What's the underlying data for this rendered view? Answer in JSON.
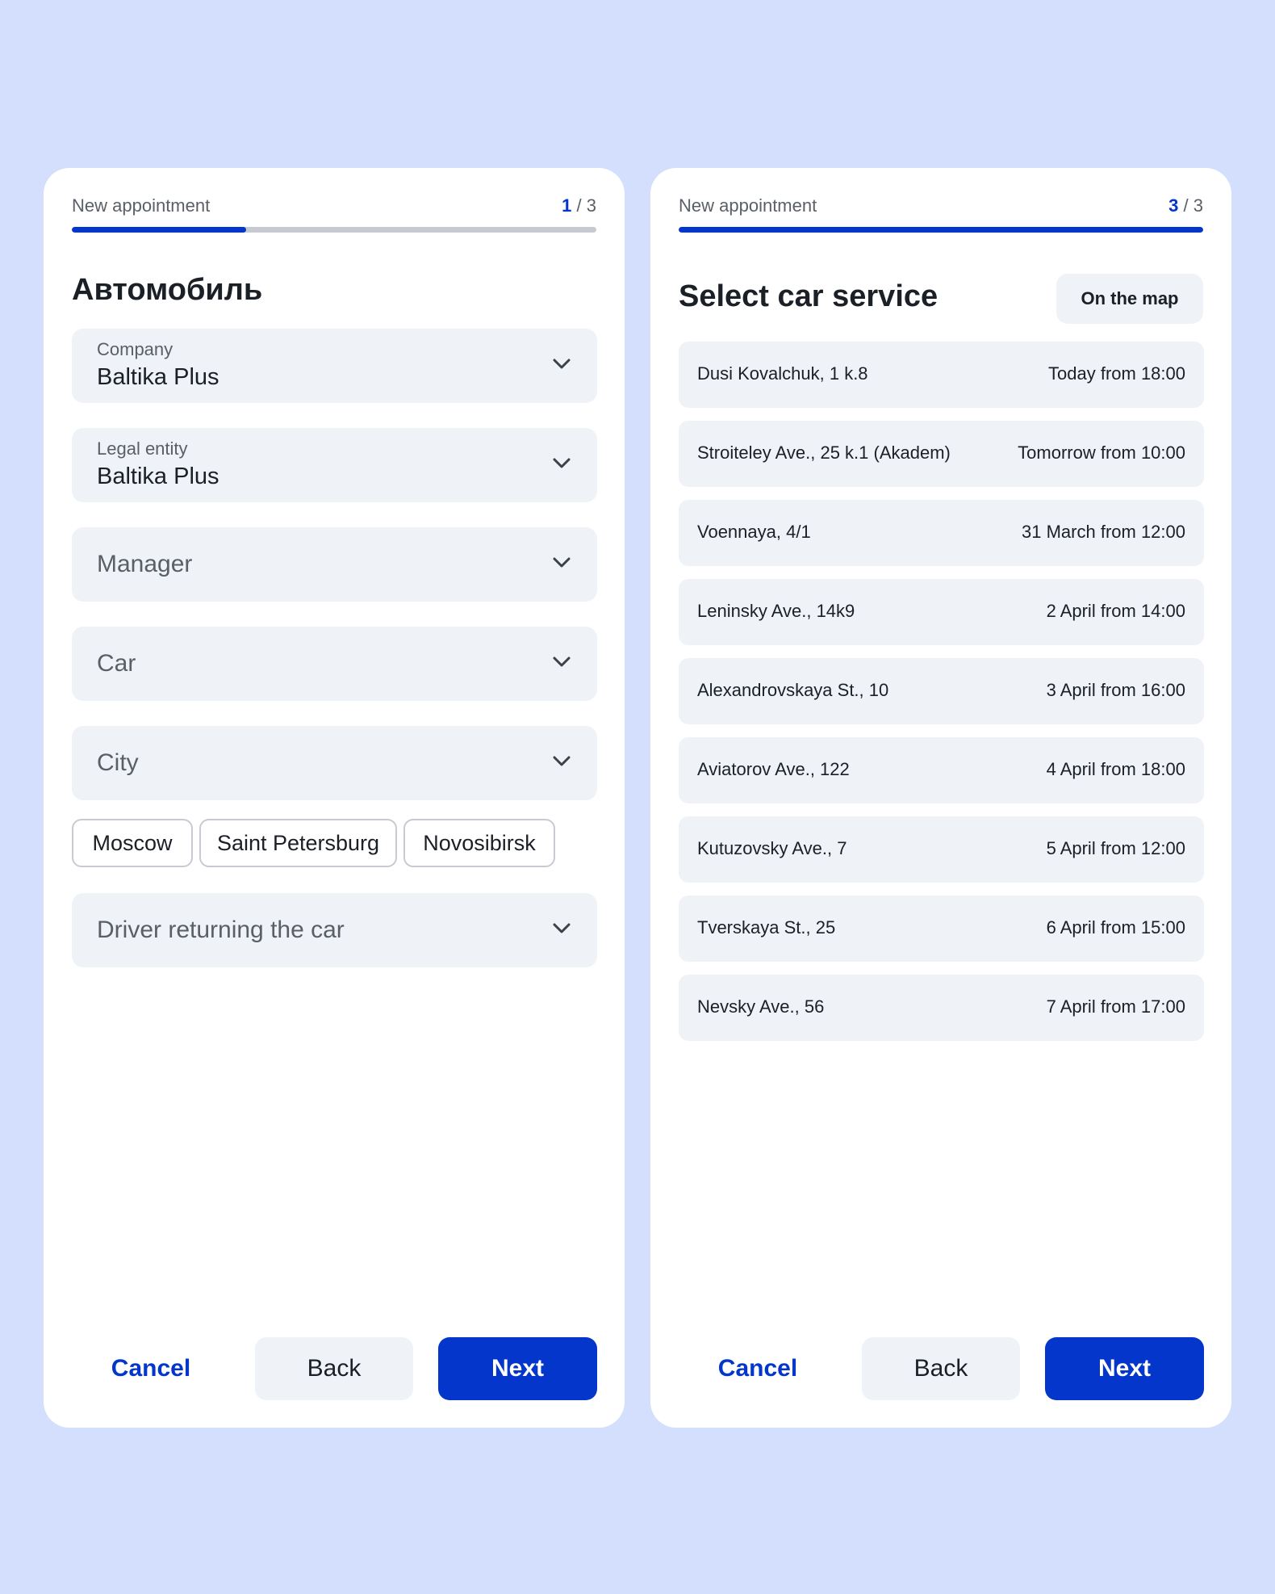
{
  "left": {
    "header_title": "New appointment",
    "step_current": "1",
    "step_total": "/ 3",
    "progress": 0.333,
    "heading": "Автомобиль",
    "fields": [
      {
        "label": "Company",
        "value": "Baltika Plus"
      },
      {
        "label": "Legal entity",
        "value": "Baltika Plus"
      },
      {
        "placeholder": "Manager"
      },
      {
        "placeholder": "Car"
      },
      {
        "placeholder": "City"
      },
      {
        "placeholder": "Driver returning the car"
      }
    ],
    "city_chips": [
      "Moscow",
      "Saint Petersburg",
      "Novosibirsk"
    ],
    "buttons": {
      "cancel": "Cancel",
      "back": "Back",
      "next": "Next"
    }
  },
  "right": {
    "header_title": "New appointment",
    "step_current": "3",
    "step_total": "/ 3",
    "progress": 1.0,
    "heading": "Select car service",
    "map_button": "On the map",
    "services": [
      {
        "address": "Dusi Kovalchuk, 1 k.8",
        "time": "Today from 18:00"
      },
      {
        "address": "Stroiteley Ave., 25 k.1 (Akadem)",
        "time": "Tomorrow from 10:00"
      },
      {
        "address": "Voennaya, 4/1",
        "time": "31 March from 12:00"
      },
      {
        "address": "Leninsky Ave., 14k9",
        "time": "2 April from 14:00"
      },
      {
        "address": "Alexandrovskaya St., 10",
        "time": "3 April from 16:00"
      },
      {
        "address": "Aviatorov Ave., 122",
        "time": "4 April from 18:00"
      },
      {
        "address": "Kutuzovsky Ave., 7",
        "time": "5 April from 12:00"
      },
      {
        "address": "Tverskaya St., 25",
        "time": "6 April from 15:00"
      },
      {
        "address": "Nevsky Ave., 56",
        "time": "7 April from 17:00"
      }
    ],
    "buttons": {
      "cancel": "Cancel",
      "back": "Back",
      "next": "Next"
    }
  },
  "colors": {
    "background": "#d3dffc",
    "accent": "#0536cc",
    "field": "#eff2f7"
  }
}
